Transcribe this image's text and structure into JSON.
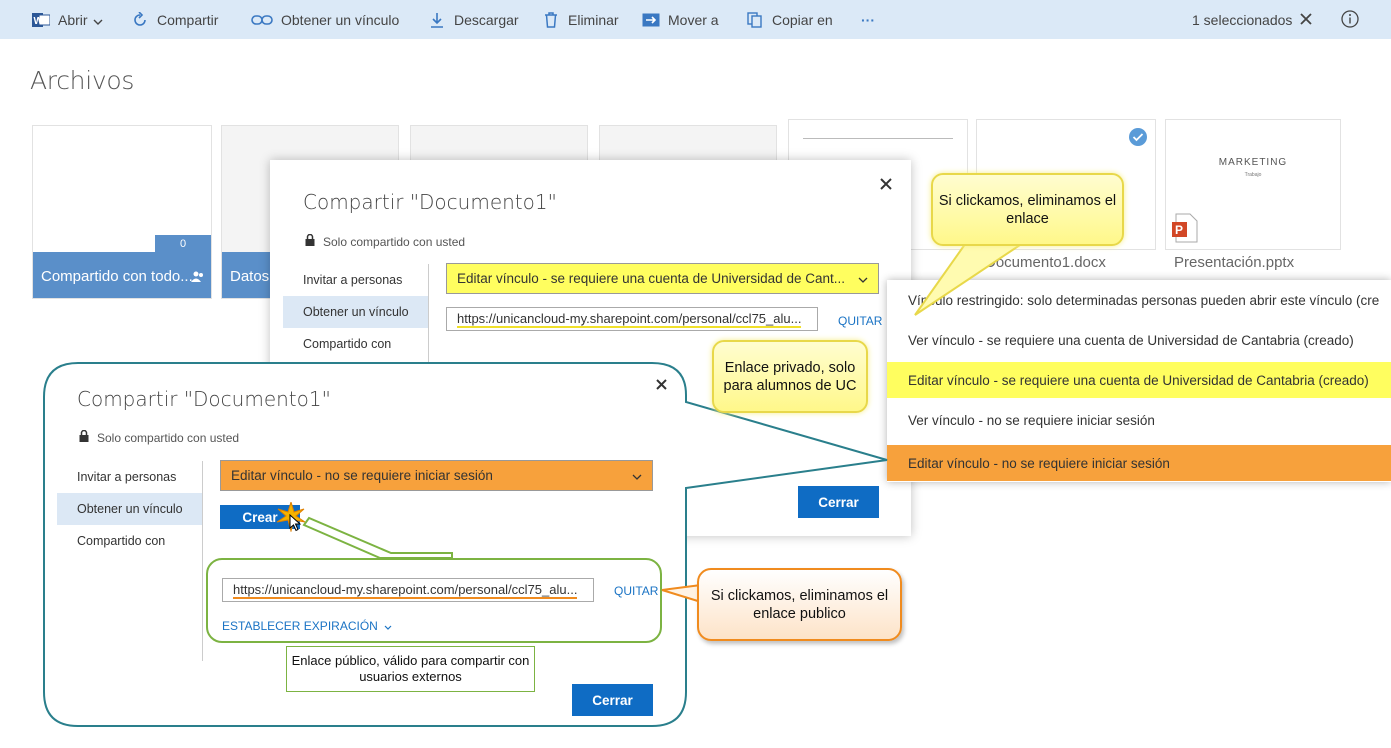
{
  "toolbar": {
    "open": "Abrir",
    "share": "Compartir",
    "get_link": "Obtener un vínculo",
    "download": "Descargar",
    "delete": "Eliminar",
    "move": "Mover a",
    "copy": "Copiar en",
    "more": "···",
    "selected": "1 seleccionados"
  },
  "page_title": "Archivos",
  "tiles": {
    "shared_label": "Compartido con todo...",
    "shared_count": "0",
    "datos_label": "Datos",
    "doc_name": "Documento1.docx",
    "pres_name": "Presentación.pptx",
    "pres_title": "MARKETING",
    "pres_sub": "Trabajo"
  },
  "dialog_back": {
    "title": "Compartir \"Documento1\"",
    "subtitle": "Solo compartido con usted",
    "nav": [
      "Invitar a personas",
      "Obtener un vínculo",
      "Compartido con"
    ],
    "select_value": "Editar vínculo - se requiere una cuenta de Universidad de Cant...",
    "url": "https://unicancloud-my.sharepoint.com/personal/ccl75_alu...",
    "remove": "QUITAR",
    "close_button": "Cerrar"
  },
  "dropdown": {
    "options": [
      "Vínculo restringido: solo determinadas personas pueden abrir este vínculo (cre",
      "Ver vínculo - se requiere una cuenta de Universidad de Cantabria (creado)",
      "Editar vínculo - se requiere una cuenta de Universidad de Cantabria (creado)",
      "Ver vínculo - no se requiere iniciar sesión",
      "Editar vínculo - no se requiere iniciar sesión"
    ],
    "highlight_yellow": "#fffe5f",
    "highlight_orange": "#f7a13c"
  },
  "dialog_front": {
    "title": "Compartir \"Documento1\"",
    "subtitle": "Solo compartido con usted",
    "nav": [
      "Invitar a personas",
      "Obtener un vínculo",
      "Compartido con"
    ],
    "select_value": "Editar vínculo - no se requiere iniciar sesión",
    "create": "Crear",
    "url": "https://unicancloud-my.sharepoint.com/personal/ccl75_alu...",
    "remove": "QUITAR",
    "expiration": "ESTABLECER EXPIRACIÓN",
    "close_button": "Cerrar"
  },
  "callouts": {
    "remove_private": "Si clickamos, eliminamos el enlace",
    "private_link": "Enlace privado, solo para alumnos de UC",
    "remove_public": "Si clickamos, eliminamos el enlace publico",
    "public_link": "Enlace público, válido para compartir con usuarios externos"
  },
  "colors": {
    "accent": "#0f6cc4",
    "toolbar_bg": "#dbe9f7",
    "tile_label": "#5a8fc9",
    "callout_outline": "#2a7f8c"
  }
}
